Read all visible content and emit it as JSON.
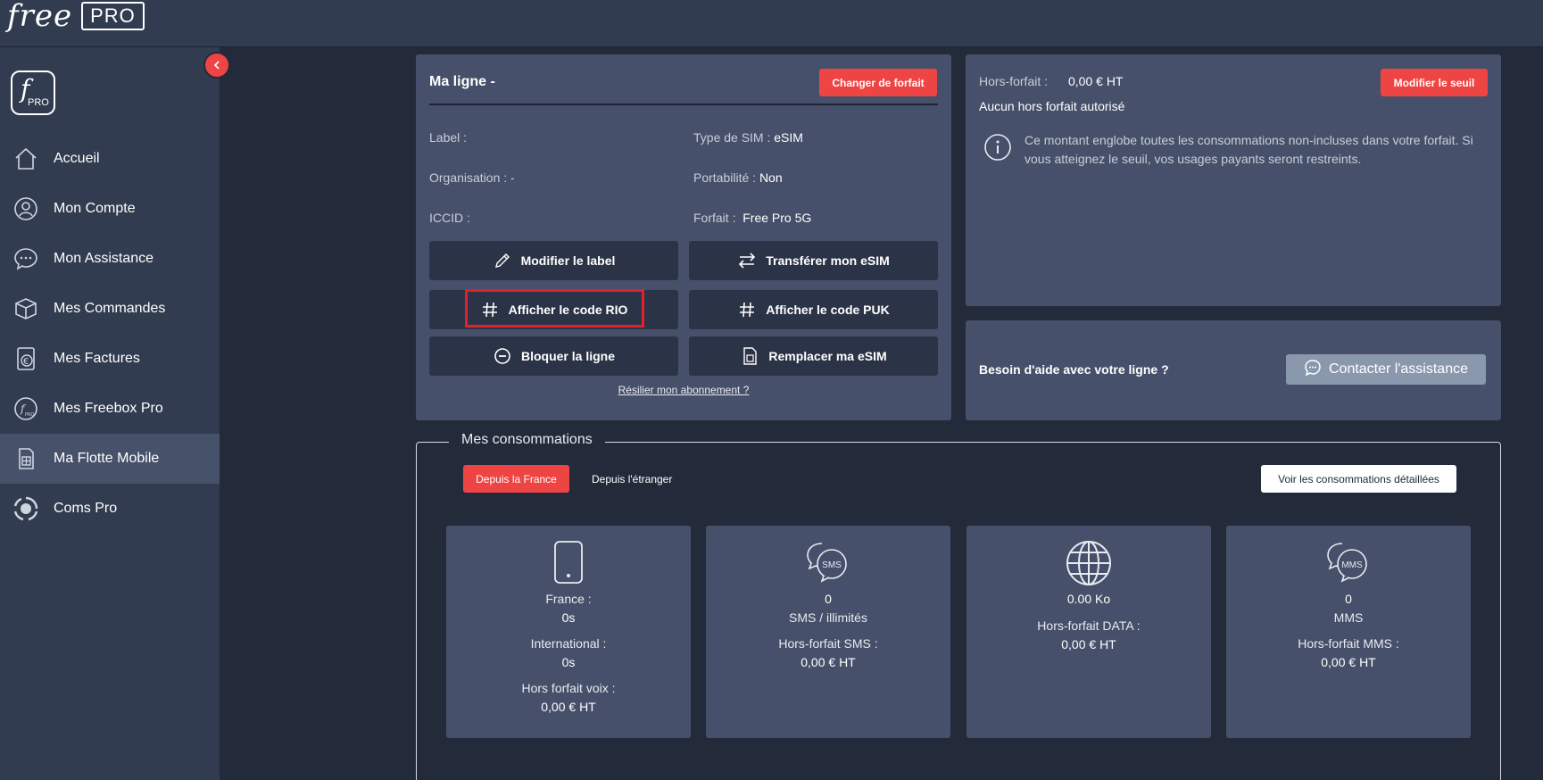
{
  "brand": {
    "free": "free",
    "pro": "PRO"
  },
  "sidebar": {
    "logo_letter": "f",
    "logo_text": "PRO",
    "items": [
      {
        "label": "Accueil",
        "icon": "home-icon"
      },
      {
        "label": "Mon Compte",
        "icon": "user-icon"
      },
      {
        "label": "Mon Assistance",
        "icon": "chat-icon"
      },
      {
        "label": "Mes Commandes",
        "icon": "box-icon"
      },
      {
        "label": "Mes Factures",
        "icon": "euro-icon"
      },
      {
        "label": "Mes Freebox Pro",
        "icon": "freebox-icon"
      },
      {
        "label": "Ma Flotte Mobile",
        "icon": "sim-icon",
        "active": true
      },
      {
        "label": "Coms Pro",
        "icon": "coms-icon"
      }
    ]
  },
  "line": {
    "title": "Ma ligne -",
    "change_plan": "Changer de forfait",
    "label_key": "Label :",
    "organisation_key": "Organisation : -",
    "iccid_key": "ICCID :",
    "sim_type_key": "Type de SIM :",
    "sim_type_val": "eSIM",
    "portability_key": "Portabilité :",
    "portability_val": "Non",
    "plan_key": "Forfait :",
    "plan_val": "Free Pro 5G",
    "actions": {
      "edit_label": "Modifier le label",
      "transfer_esim": "Transférer mon eSIM",
      "show_rio": "Afficher le code RIO",
      "show_puk": "Afficher le code PUK",
      "block_line": "Bloquer la ligne",
      "replace_esim": "Remplacer ma eSIM"
    },
    "cancel_link": "Résilier mon abonnement ?"
  },
  "hors_forfait": {
    "label": "Hors-forfait :",
    "value": "0,00 € HT",
    "none": "Aucun hors forfait autorisé",
    "modify": "Modifier le seuil",
    "info": "Ce montant englobe toutes les consommations non-incluses dans votre forfait. Si vous atteignez le seuil, vos usages payants seront restreints."
  },
  "help": {
    "text": "Besoin d'aide avec votre ligne ?",
    "button": "Contacter l'assistance"
  },
  "conso": {
    "title": "Mes consommations",
    "tab_france": "Depuis la France",
    "tab_abroad": "Depuis l'étranger",
    "detail_button": "Voir les consommations détaillées",
    "voice": {
      "france_label": "France :",
      "france_val": "0s",
      "intl_label": "International :",
      "intl_val": "0s",
      "hf_label": "Hors forfait voix :",
      "hf_val": "0,00 € HT"
    },
    "sms": {
      "badge": "SMS",
      "count": "0",
      "label": "SMS / illimités",
      "hf_label": "Hors-forfait SMS :",
      "hf_val": "0,00 € HT"
    },
    "data": {
      "amount": "0.00 Ko",
      "hf_label": "Hors-forfait DATA :",
      "hf_val": "0,00 € HT"
    },
    "mms": {
      "badge": "MMS",
      "count": "0",
      "label": "MMS",
      "hf_label": "Hors-forfait MMS :",
      "hf_val": "0,00 € HT"
    }
  },
  "colors": {
    "accent": "#ef4444",
    "panel": "#46506a",
    "background": "#232a3a",
    "sidebar": "#323c50",
    "highlight": "#e3202e"
  }
}
